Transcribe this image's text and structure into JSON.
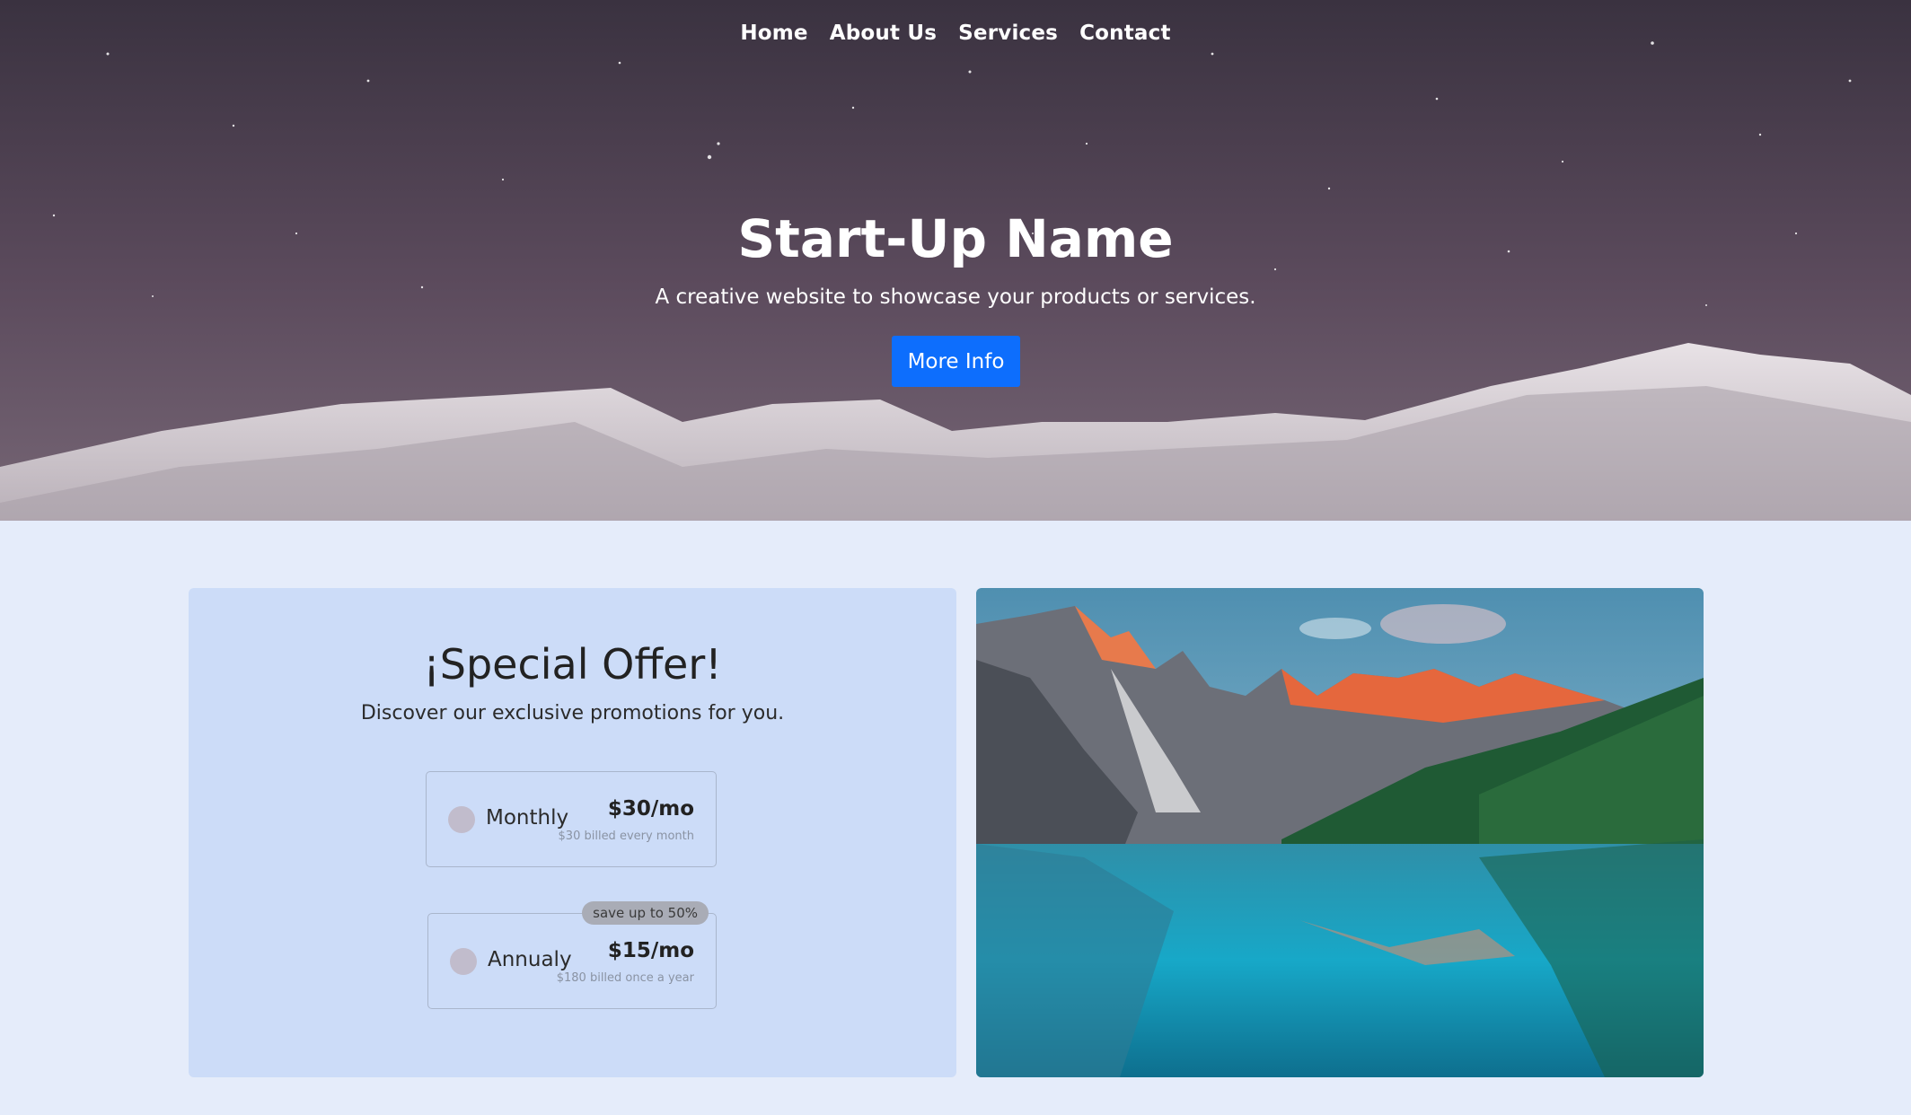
{
  "nav": {
    "items": [
      "Home",
      "About Us",
      "Services",
      "Contact"
    ]
  },
  "hero": {
    "title": "Start-Up Name",
    "subtitle": "A creative website to showcase your products or services.",
    "button_label": "More Info"
  },
  "offer": {
    "title": "¡Special Offer!",
    "subtitle": "Discover our exclusive promotions for you.",
    "plans": [
      {
        "name": "Monthly",
        "price": "$30/mo",
        "note": "$30 billed every month",
        "badge": ""
      },
      {
        "name": "Annualy",
        "price": "$15/mo",
        "note": "$180 billed once a year",
        "badge": "save up to 50%"
      }
    ]
  },
  "colors": {
    "accent": "#0d6efd",
    "page_bg": "#e5ecfa",
    "offer_bg": "#ccdcf8"
  },
  "icons": {
    "radio": "radio-unchecked-icon"
  }
}
